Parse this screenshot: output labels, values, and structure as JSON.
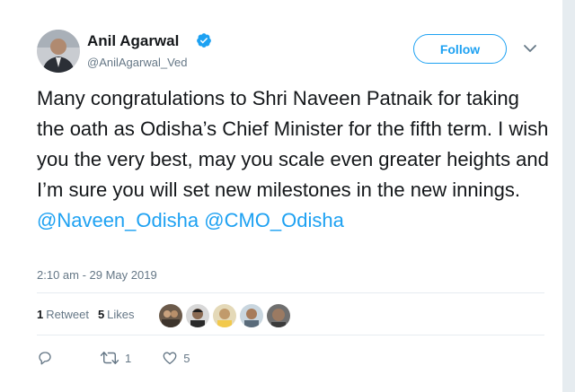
{
  "author": {
    "name": "Anil Agarwal",
    "handle": "@AnilAgarwal_Ved",
    "verified": true
  },
  "follow_button": {
    "label": "Follow"
  },
  "tweet": {
    "text_plain": "Many congratulations to Shri Naveen Patnaik for taking the oath as Odisha’s Chief Minister for the fifth term. I wish you the very best, may you scale even greater heights and I’m sure you will set new milestones in the new innings.",
    "mentions": [
      "@Naveen_Odisha",
      "@CMO_Odisha"
    ],
    "timestamp": "2:10 am - 29 May 2019"
  },
  "stats": {
    "retweets_count": "1",
    "retweets_label": "Retweet",
    "likes_count": "5",
    "likes_label": "Likes"
  },
  "actions": {
    "reply_icon": "reply-icon",
    "retweet_icon": "retweet-icon",
    "retweet_count": "1",
    "like_icon": "heart-icon",
    "like_count": "5"
  },
  "colors": {
    "accent": "#1da1f2",
    "text_primary": "#14171a",
    "text_secondary": "#657786",
    "divider": "#e6ecf0"
  }
}
